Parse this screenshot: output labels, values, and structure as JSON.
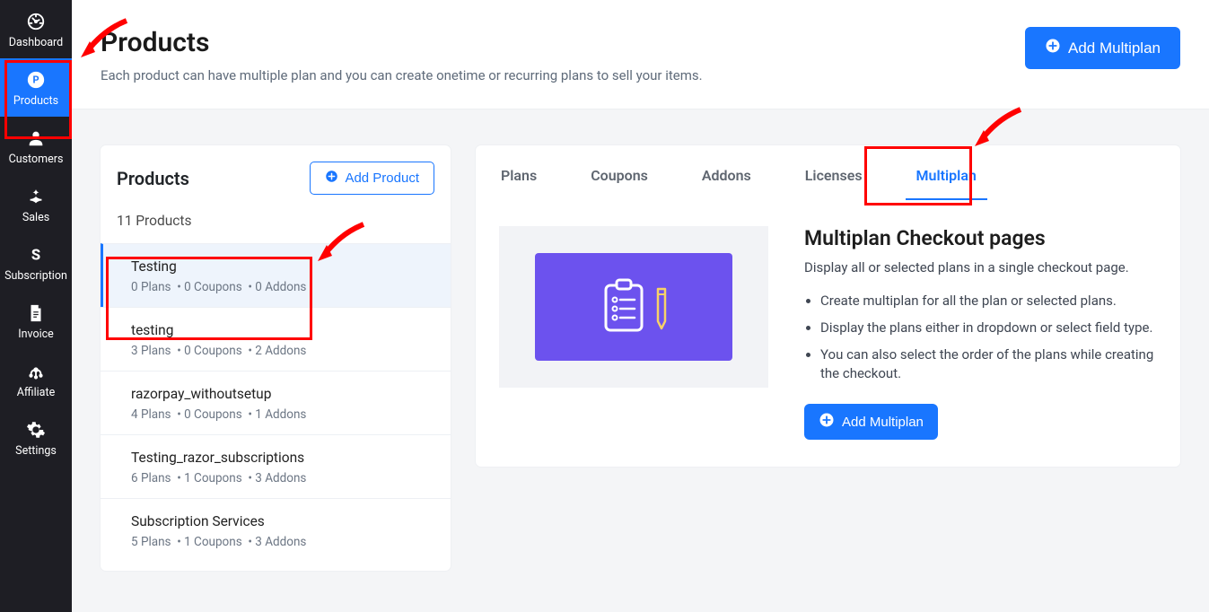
{
  "sidebar": {
    "items": [
      {
        "label": "Dashboard",
        "icon": "dashboard"
      },
      {
        "label": "Products",
        "icon": "products",
        "active": true
      },
      {
        "label": "Customers",
        "icon": "customers"
      },
      {
        "label": "Sales",
        "icon": "sales"
      },
      {
        "label": "Subscription",
        "icon": "subscription"
      },
      {
        "label": "Invoice",
        "icon": "invoice"
      },
      {
        "label": "Affiliate",
        "icon": "affiliate"
      },
      {
        "label": "Settings",
        "icon": "settings"
      }
    ]
  },
  "header": {
    "title": "Products",
    "subtitle": "Each product can have multiple plan and you can create onetime or recurring plans to sell your items.",
    "add_multiplan": "Add Multiplan"
  },
  "products_panel": {
    "title": "Products",
    "add_product": "Add Product",
    "count_label": "11 Products",
    "items": [
      {
        "name": "Testing",
        "plans": 0,
        "coupons": 0,
        "addons": 0,
        "active": true
      },
      {
        "name": "testing",
        "plans": 3,
        "coupons": 0,
        "addons": 2
      },
      {
        "name": "razorpay_withoutsetup",
        "plans": 4,
        "coupons": 0,
        "addons": 1
      },
      {
        "name": "Testing_razor_subscriptions",
        "plans": 6,
        "coupons": 1,
        "addons": 3
      },
      {
        "name": "Subscription Services",
        "plans": 5,
        "coupons": 1,
        "addons": 3
      }
    ]
  },
  "tabs": [
    {
      "label": "Plans"
    },
    {
      "label": "Coupons"
    },
    {
      "label": "Addons"
    },
    {
      "label": "Licenses"
    },
    {
      "label": "Multiplan",
      "active": true
    }
  ],
  "multiplan": {
    "title": "Multiplan Checkout pages",
    "description": "Display all or selected plans in a single checkout page.",
    "bullets": [
      "Create multiplan for all the plan or selected plans.",
      "Display the plans either in dropdown or select field type.",
      "You can also select the order of the plans while creating the checkout."
    ],
    "add_button": "Add Multiplan"
  }
}
